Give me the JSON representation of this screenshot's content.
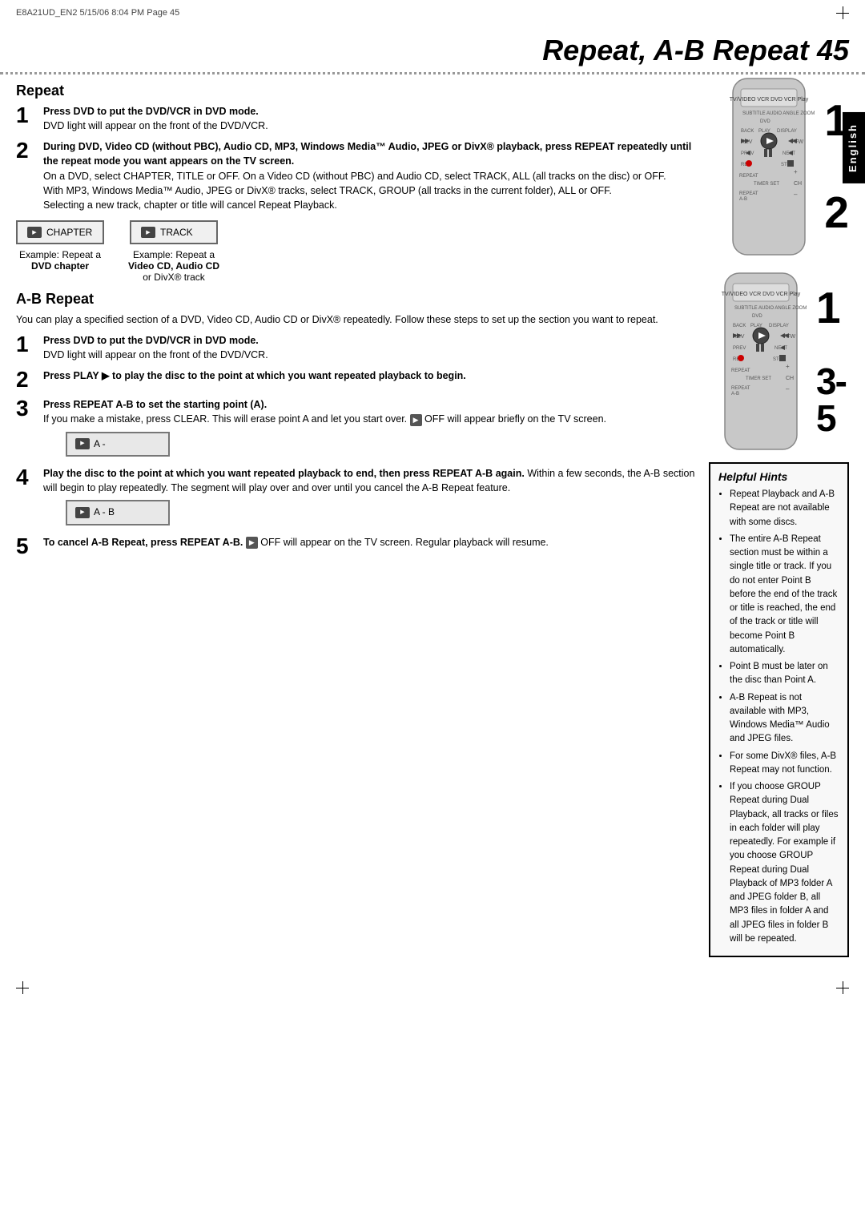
{
  "header": {
    "file_info": "E8A21UD_EN2  5/15/06  8:04 PM  Page 45"
  },
  "title": {
    "text": "Repeat, A-B Repeat",
    "page_number": "45"
  },
  "english_tab": "English",
  "repeat_section": {
    "heading": "Repeat",
    "step1": {
      "number": "1",
      "bold_text": "Press DVD to put the DVD/VCR in DVD mode.",
      "normal_text": "DVD light will appear on the front of the DVD/VCR."
    },
    "step2": {
      "number": "2",
      "bold_text": "During DVD, Video CD (without PBC), Audio CD, MP3, Windows Media™ Audio, JPEG or DivX® playback, press REPEAT repeatedly until the repeat mode you want appears on the TV screen.",
      "normal_text1": "On a DVD, select CHAPTER, TITLE or OFF. On a Video CD (without PBC) and Audio CD, select TRACK, ALL (all tracks on the disc) or OFF.",
      "normal_text2": "With MP3, Windows Media™ Audio, JPEG or DivX® tracks, select TRACK, GROUP (all tracks in the current folder), ALL or OFF.",
      "normal_text3": "Selecting a new track, chapter or title will cancel Repeat Playback."
    },
    "screen_example1": {
      "label": "CHAPTER",
      "caption_line1": "Example: Repeat a",
      "caption_line2": "DVD chapter"
    },
    "screen_example2": {
      "label": "TRACK",
      "caption_line1": "Example: Repeat a",
      "caption_line2": "Video CD, Audio CD",
      "caption_line3": "or DivX® track"
    }
  },
  "ab_repeat_section": {
    "heading": "A-B Repeat",
    "intro": "You can play a specified section of a DVD, Video CD, Audio CD or DivX® repeatedly. Follow these steps to set up the section you want to repeat.",
    "step1": {
      "number": "1",
      "bold_text": "Press DVD to put the DVD/VCR in DVD mode.",
      "normal_text": "DVD light will appear on the front of the DVD/VCR."
    },
    "step2": {
      "number": "2",
      "bold_text": "Press PLAY ▶ to play the disc to the point at which you want repeated playback to begin."
    },
    "step3": {
      "number": "3",
      "bold_text": "Press REPEAT A-B to set the starting point (A).",
      "normal_text": "If you make a mistake, press CLEAR. This will erase point A and let you start over.",
      "osd_text": "OFF will appear briefly on the TV screen.",
      "osd_label": "A -"
    },
    "step4": {
      "number": "4",
      "bold_text1": "Play the disc to the point at which you want repeated playback to end, then press REPEAT A-B",
      "bold_text2": "again.",
      "normal_text": "Within a few seconds, the A-B section will begin to play repeatedly. The segment will play over and over until you cancel the A-B Repeat feature.",
      "osd_label": "A - B"
    },
    "step5": {
      "number": "5",
      "bold_text": "To cancel A-B Repeat, press REPEAT A-B.",
      "osd_off": "OFF will",
      "normal_text": "appear on the TV screen. Regular playback will resume."
    },
    "side_label": "3-5"
  },
  "helpful_hints": {
    "title": "Helpful Hints",
    "hints": [
      "Repeat Playback and A-B Repeat are not available with some discs.",
      "The entire A-B Repeat section must be within a single title or track. If you do not enter Point B before the end of the track or title is reached, the end of the track or title will become Point B automatically.",
      "Point B must be later on the disc than Point A.",
      "A-B Repeat is not available with MP3, Windows Media™ Audio and JPEG files.",
      "For some DivX® files, A-B Repeat may not function.",
      "If you choose GROUP Repeat during Dual Playback, all tracks or files in each folder will play repeatedly. For example if you choose GROUP Repeat during Dual Playback of MP3 folder A and JPEG folder B, all MP3 files in folder A and all JPEG files in folder B will be repeated."
    ]
  },
  "right_column": {
    "number1_top": "1",
    "number2_top": "2",
    "number1_bottom": "1"
  }
}
